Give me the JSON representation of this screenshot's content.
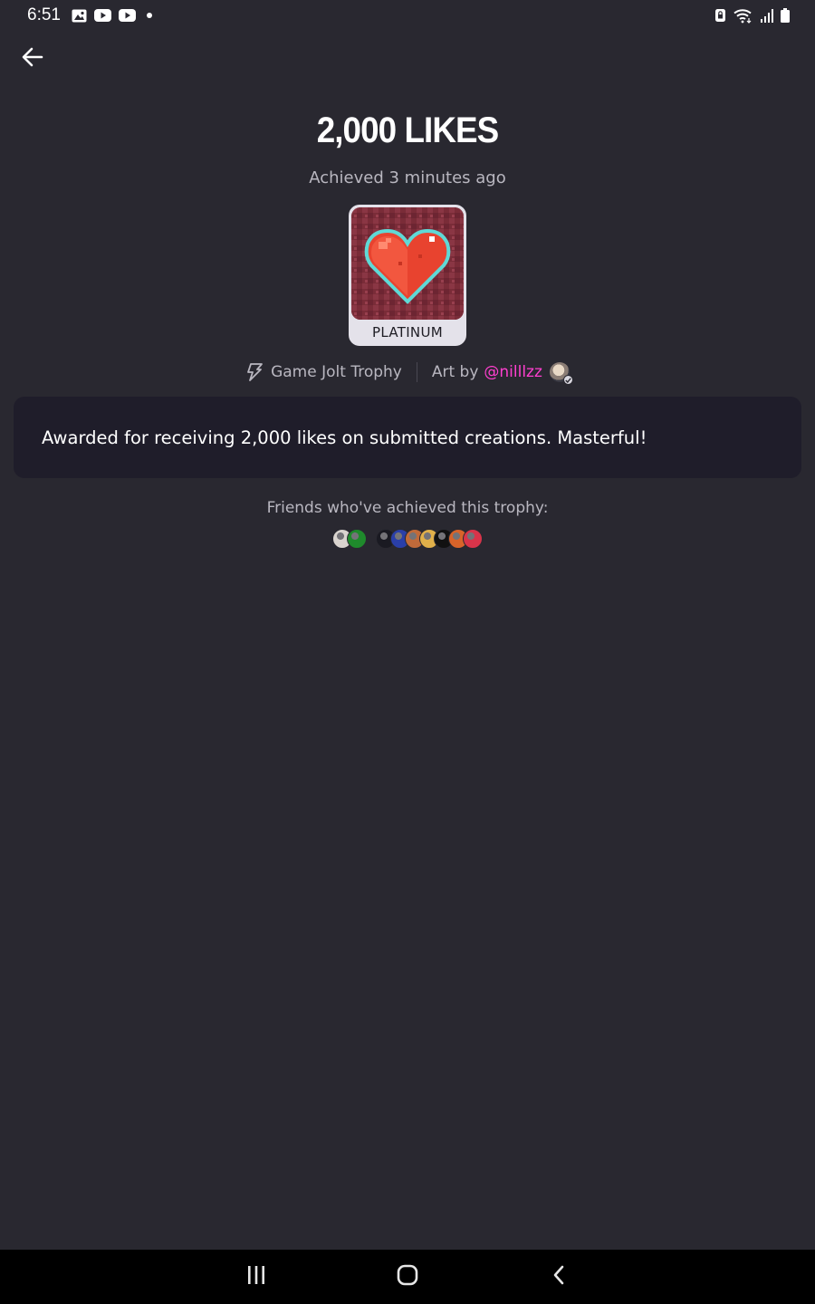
{
  "status_bar": {
    "time": "6:51",
    "left_icons": [
      "gallery-icon",
      "youtube-icon",
      "youtube-icon",
      "notification-dot"
    ],
    "right_icons": [
      "lock-icon",
      "wifi-icon",
      "signal-icon",
      "battery-icon"
    ]
  },
  "header": {
    "back_icon": "arrow-left-icon"
  },
  "trophy": {
    "title": "2,000 LIKES",
    "achieved": "Achieved 3 minutes ago",
    "tier": "PLATINUM",
    "image_icon": "pixel-heart-icon",
    "source": "Game Jolt Trophy",
    "art_by_label": "Art by",
    "artist": "@nilllzz",
    "description": "Awarded for receiving 2,000 likes on submitted creations. Masterful!"
  },
  "friends": {
    "label": "Friends who've achieved this trophy:",
    "groups": [
      [
        {
          "color": "#d9d4cf"
        },
        {
          "color": "#1f8a2c"
        }
      ],
      [
        {
          "color": "#1a1a22"
        },
        {
          "color": "#2a3fa8"
        },
        {
          "color": "#c06a3a"
        },
        {
          "color": "#e0b04a"
        },
        {
          "color": "#111111"
        },
        {
          "color": "#d8642a"
        },
        {
          "color": "#d8344a"
        }
      ]
    ]
  },
  "nav_bar": {
    "icons": [
      "recents-icon",
      "home-icon",
      "back-icon"
    ]
  },
  "colors": {
    "background": "#292830",
    "card": "#1f1d2a",
    "accent_link": "#ff3fcf",
    "muted_text": "#b9b7c0"
  }
}
